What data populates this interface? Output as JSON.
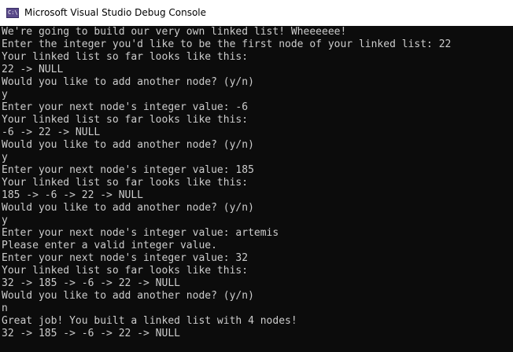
{
  "window": {
    "title": "Microsoft Visual Studio Debug Console",
    "icon": "console-app-icon",
    "icon_label": "C:\\"
  },
  "colors": {
    "console_background": "#0c0c0c",
    "console_text": "#cccccc",
    "titlebar_background": "#ffffff",
    "titlebar_text": "#000000"
  },
  "console": {
    "lines": [
      "We're going to build our very own linked list! Wheeeeee!",
      "Enter the integer you'd like to be the first node of your linked list: 22",
      "Your linked list so far looks like this:",
      "22 -> NULL",
      "Would you like to add another node? (y/n)",
      "y",
      "Enter your next node's integer value: -6",
      "Your linked list so far looks like this:",
      "-6 -> 22 -> NULL",
      "Would you like to add another node? (y/n)",
      "y",
      "Enter your next node's integer value: 185",
      "Your linked list so far looks like this:",
      "185 -> -6 -> 22 -> NULL",
      "Would you like to add another node? (y/n)",
      "y",
      "Enter your next node's integer value: artemis",
      "Please enter a valid integer value.",
      "Enter your next node's integer value: 32",
      "Your linked list so far looks like this:",
      "32 -> 185 -> -6 -> 22 -> NULL",
      "Would you like to add another node? (y/n)",
      "n",
      "Great job! You built a linked list with 4 nodes!",
      "32 -> 185 -> -6 -> 22 -> NULL"
    ]
  }
}
